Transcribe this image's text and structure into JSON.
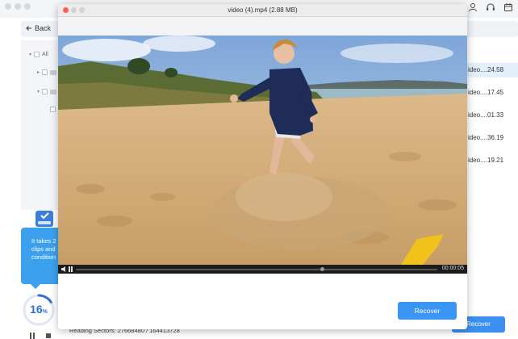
{
  "main": {
    "back_label": "Back",
    "tree": {
      "root_label": "All"
    },
    "promo": {
      "lines": [
        "It takes 2",
        "clips and",
        "condition"
      ]
    },
    "scan_progress": {
      "percent": 16,
      "value_label": "16",
      "unit": "%"
    },
    "reading_sectors": "Reading Sectors: 27668480 / 164413728",
    "files": [
      "ideo....24.58",
      "ideo....17.45",
      "ideo....01.33",
      "ideo....36.19",
      "ideo....19.21"
    ],
    "selected_file_index": 0,
    "recover_label": "Recover"
  },
  "preview": {
    "title": "video (4).mp4 (2.88 MB)",
    "player": {
      "time": "00:00:05",
      "progress_fraction": 0.68
    },
    "recover_label": "Recover"
  },
  "colors": {
    "accent": "#3b95f5",
    "promo": "#3ba1ef",
    "progress": "#2f6fd6",
    "close_dot": "#fc5f57"
  },
  "icons": [
    "user-icon",
    "headset-icon",
    "calendar-icon",
    "back-arrow-icon",
    "drive-icon",
    "volume-icon",
    "pause-icon"
  ]
}
